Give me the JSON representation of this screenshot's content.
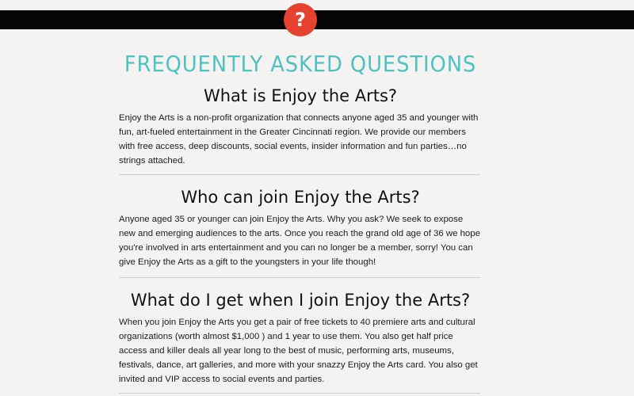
{
  "header": {
    "help_icon_glyph": "?",
    "help_icon_color": "#e7422f",
    "bar_color": "#050505"
  },
  "page": {
    "title": "FREQUENTLY ASKED QUESTIONS",
    "title_color": "#4ec2c2"
  },
  "faqs": [
    {
      "question": "What is Enjoy the Arts?",
      "answer": "Enjoy the Arts is a non-profit organization that connects anyone aged 35 and younger with fun, art-fueled entertainment in the Greater Cincinnati region. We provide our members with free access, deep discounts, social events, insider information and fun parties…no strings attached."
    },
    {
      "question": "Who can join Enjoy the Arts?",
      "answer": "Anyone aged 35 or younger can join Enjoy the Arts. Why you ask? We seek to expose new and emerging audiences to the arts. Once you reach the grand old age of 36 we hope you're involved in arts entertainment and you can no longer be a member, sorry! You can give Enjoy the Arts as a gift to the youngsters in your life though!"
    },
    {
      "question": "What do I get when I join Enjoy the Arts?",
      "answer": "When you join Enjoy the Arts you get a pair of free tickets to 40 premiere arts and cultural organizations (worth almost $1,000 ) and 1 year to use them. You also get half price access and killer deals all year long to the best of music, performing arts, museums, festivals, dance, art galleries, and more with your snazzy Enjoy the Arts card. You also get invited and VIP access to social events and parties."
    }
  ]
}
